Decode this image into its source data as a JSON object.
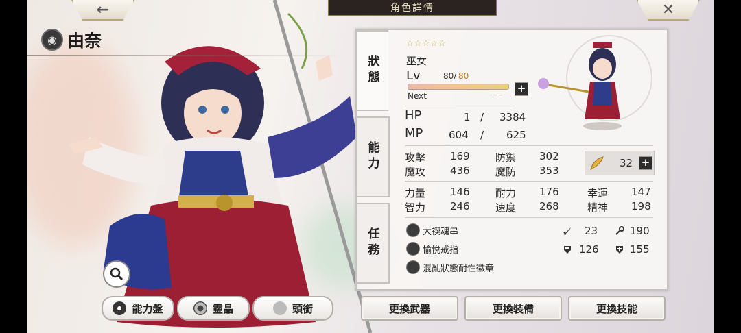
{
  "header": {
    "title": "角色詳情",
    "back_icon": "←",
    "close_icon": "✕"
  },
  "character": {
    "name": "由奈",
    "rarity_stars": "☆☆☆☆☆",
    "job": "巫女"
  },
  "tabs": [
    "狀態",
    "能力",
    "任務"
  ],
  "level": {
    "label": "Lv",
    "current": "80/",
    "max": "80",
    "next_label": "Next",
    "next_value": "-- -- --",
    "progress": 1.0
  },
  "hp": {
    "label": "HP",
    "current": "1",
    "sep": "/",
    "max": "3384"
  },
  "mp": {
    "label": "MP",
    "current": "604",
    "sep": "/",
    "max": "625"
  },
  "combat_stats": [
    {
      "label": "攻擊",
      "value": "169"
    },
    {
      "label": "防禦",
      "value": "302"
    },
    {
      "label": "魔攻",
      "value": "436"
    },
    {
      "label": "魔防",
      "value": "353"
    }
  ],
  "feather_points": "32",
  "attributes": [
    {
      "label": "力量",
      "value": "146"
    },
    {
      "label": "耐力",
      "value": "176"
    },
    {
      "label": "幸運",
      "value": "147"
    },
    {
      "label": "智力",
      "value": "246"
    },
    {
      "label": "速度",
      "value": "268"
    },
    {
      "label": "精神",
      "value": "198"
    }
  ],
  "equipment": [
    {
      "name": "大禊魂串"
    },
    {
      "name": "愉悅戒指"
    },
    {
      "name": "混亂狀態耐性徽章"
    }
  ],
  "equip_stats": {
    "sword": "23",
    "wand": "190",
    "shield": "126",
    "cross": "155"
  },
  "plus_label": "+",
  "bottom_left_buttons": [
    {
      "label": "能力盤"
    },
    {
      "label": "靈晶"
    },
    {
      "label": "頭銜"
    }
  ],
  "bottom_right_buttons": [
    {
      "label": "更換武器"
    },
    {
      "label": "更換裝備"
    },
    {
      "label": "更換技能"
    }
  ],
  "colors": {
    "accent_gold": "#c7a94f",
    "panel_bg": "#f8f6f4",
    "dark_tab": "#2b2320"
  }
}
